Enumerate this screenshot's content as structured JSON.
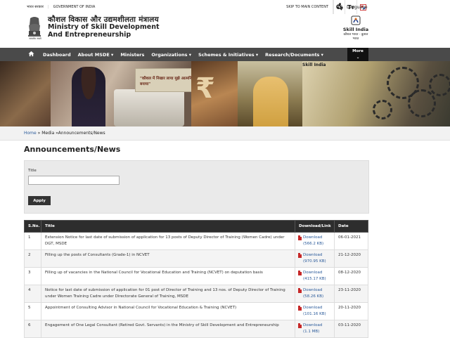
{
  "topbar": {
    "govt_hindi": "भारत सरकार",
    "govt_english": "GOVERNMENT OF INDIA",
    "skip_link": "SKIP TO MAIN CONTENT",
    "text_size_icon": "Tт",
    "language_label": "Language"
  },
  "header": {
    "ministry_hindi": "कौशल विकास और उद्यमशीलता मंत्रालय",
    "ministry_english_line1": "Ministry of Skill Development",
    "ministry_english_line2": "And Entrepreneurship",
    "emblem_caption": "सत्यमेव जयते",
    "skill_india_name": "Skill India",
    "skill_india_tagline": "कौशल भारत - कुशल भारत"
  },
  "nav": {
    "home_icon": "home-icon",
    "items": [
      {
        "label": "Dashboard"
      },
      {
        "label": "About MSDE ▾"
      },
      {
        "label": "Ministers"
      },
      {
        "label": "Organizations ▾"
      },
      {
        "label": "Schemes & Initiatives ▾"
      },
      {
        "label": "Research/Documents ▾"
      }
    ],
    "more_label": "More",
    "more_chevron": "⌄"
  },
  "banner": {
    "poster_text": "\"कौशल में निखार लाया मुझे आत्मनिर्भर बनाया\"",
    "skill_india_label": "Skill India"
  },
  "breadcrumb": {
    "home": "Home",
    "sep1": " » ",
    "media": "Media",
    "sep2": " »",
    "current": "Announcements/News"
  },
  "page_title": "Announcements/News",
  "filter": {
    "title_label": "Title",
    "title_value": "",
    "apply_label": "Apply"
  },
  "table": {
    "headers": [
      "S.No.",
      "Title",
      "Download/Link",
      "Date"
    ],
    "rows": [
      {
        "sno": "1",
        "title": "Extension Notice for last date of submission of application for 13 posts of Deputy Director of Training (Women Cadre) under DGT, MSDE",
        "link": "Download",
        "size": "(566.2 KB)",
        "date": "06-01-2021"
      },
      {
        "sno": "2",
        "title": "Filling up the posts of Consultants (Grade-1) in NCVET",
        "link": "Download",
        "size": "(970.95 KB)",
        "date": "21-12-2020"
      },
      {
        "sno": "3",
        "title": "Filling up of vacancies in the National Council for Vocational Education and Training (NCVET) on deputation basis",
        "link": "Download",
        "size": "(415.17 KB)",
        "date": "08-12-2020"
      },
      {
        "sno": "4",
        "title": "Notice for last date of submission of application for 01 post of Director of Training and 13 nos. of Deputy Director of Training under Women Training Cadre under Directorate General of Training, MSDE",
        "link": "Download",
        "size": "(58.26 KB)",
        "date": "23-11-2020"
      },
      {
        "sno": "5",
        "title": "Appointment of Consulting Advisor in National Council for Vocational Education & Training (NCVET)",
        "link": "Download",
        "size": "(101.16 KB)",
        "date": "20-11-2020"
      },
      {
        "sno": "6",
        "title": "Engagement of One Legal Consultant (Retired Govt. Servants) in the Ministry of Skill Development and Entrepreneurship",
        "link": "Download",
        "size": "(1.1 MB)",
        "date": "03-11-2020"
      }
    ]
  },
  "colors": {
    "nav_bg": "#4a4a4a",
    "table_header_bg": "#2d2d2d",
    "link_blue": "#2a5a9a",
    "pdf_red": "#c62828"
  }
}
